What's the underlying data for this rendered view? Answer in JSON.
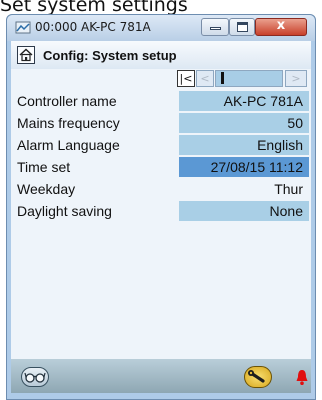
{
  "caption": "Set system settings",
  "window": {
    "title": "00:000 AK-PC 781A",
    "close_glyph": "x",
    "min_icon": "minimize-icon",
    "max_icon": "maximize-icon"
  },
  "header": {
    "title": "Config: System setup",
    "home_icon": "home-icon"
  },
  "nav": {
    "first": "|<",
    "prev": "<",
    "next": ">"
  },
  "settings": [
    {
      "label": "Controller name",
      "value": "AK-PC 781A",
      "style": "light"
    },
    {
      "label": "Mains frequency",
      "value": "50",
      "style": "light"
    },
    {
      "label": "Alarm Language",
      "value": "English",
      "style": "light"
    },
    {
      "label": "Time set",
      "value": "27/08/15 11:12",
      "style": "dark"
    },
    {
      "label": "Weekday",
      "value": "Thur",
      "style": "plain"
    },
    {
      "label": "Daylight saving",
      "value": "None",
      "style": "light"
    }
  ],
  "footer": {
    "view_icon": "glasses-icon",
    "service_icon": "wrench-icon",
    "alarm_icon": "alarm-bell-icon"
  },
  "colors": {
    "field_light": "#a9cfe6",
    "field_selected": "#5b98d4",
    "close_button": "#c8402a",
    "alarm": "#e01010"
  }
}
